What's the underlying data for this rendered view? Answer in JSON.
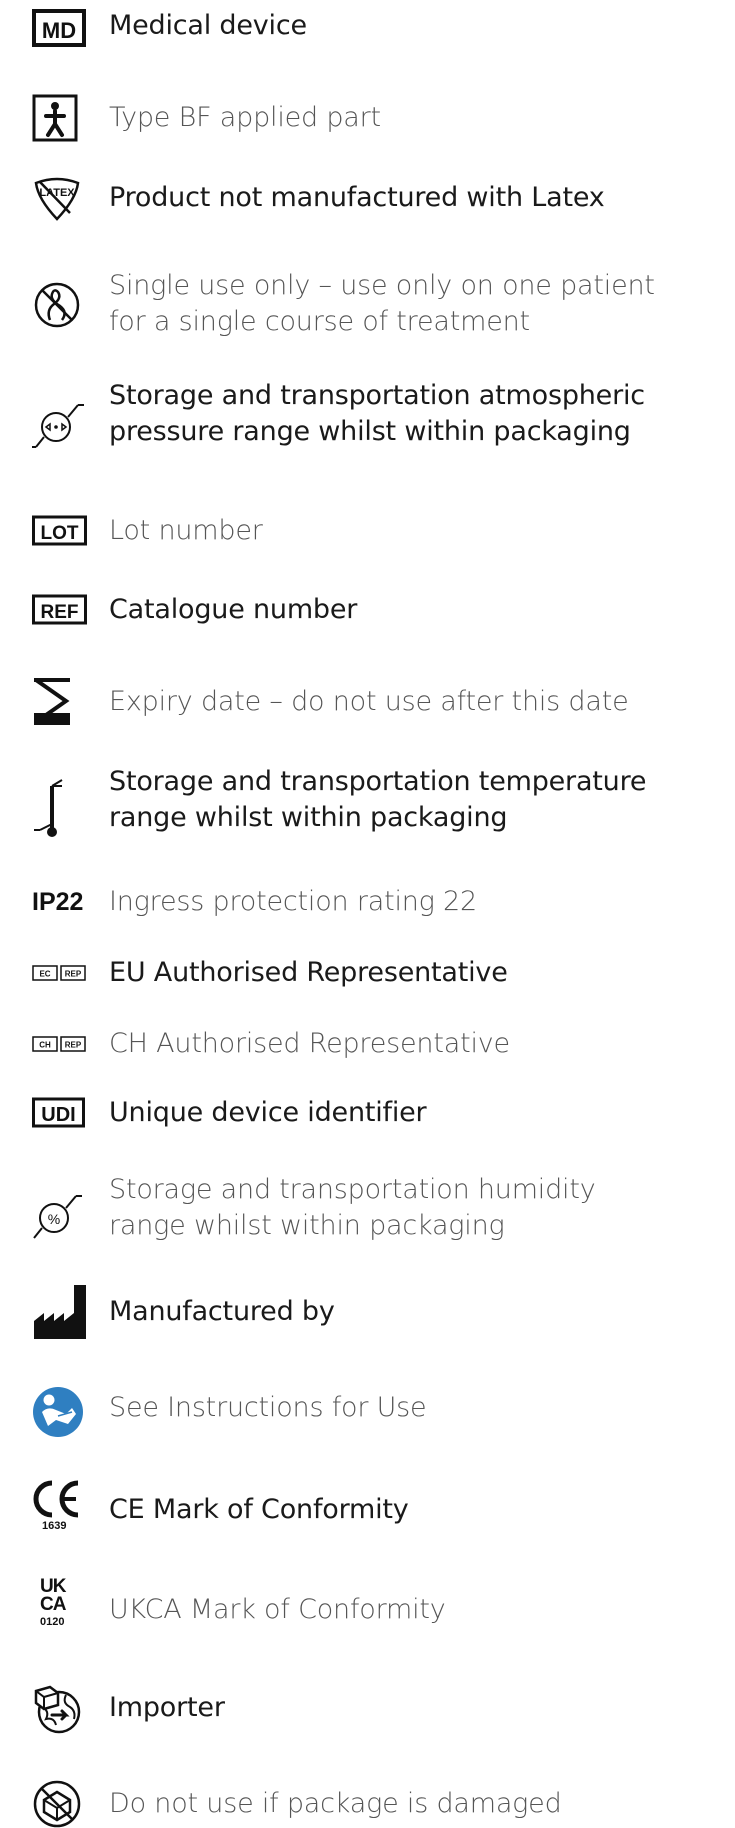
{
  "symbols": [
    {
      "icon": "md-icon",
      "text": "Medical device",
      "style": "bold",
      "lines": 1
    },
    {
      "icon": "type-bf-applied-part-icon",
      "text": "Type BF applied part",
      "style": "light",
      "lines": 1
    },
    {
      "icon": "latex-free-icon",
      "icon_text": "LATEX",
      "text": "Product not manufactured with Latex",
      "style": "bold",
      "lines": 1
    },
    {
      "icon": "single-use-icon",
      "text": "Single use only – use only on one patient for a single course of treatment",
      "style": "light",
      "lines": 2
    },
    {
      "icon": "atmospheric-pressure-icon",
      "text": "Storage and transportation atmospheric pressure range whilst within packaging",
      "style": "bold",
      "lines": 2
    },
    {
      "icon": "lot-icon",
      "icon_text": "LOT",
      "text": "Lot number",
      "style": "light",
      "lines": 1
    },
    {
      "icon": "ref-icon",
      "icon_text": "REF",
      "text": "Catalogue number",
      "style": "bold",
      "lines": 1
    },
    {
      "icon": "hourglass-icon",
      "text": "Expiry date – do not use after this date",
      "style": "light",
      "lines": 1
    },
    {
      "icon": "temperature-limit-icon",
      "text": "Storage and transportation temperature range whilst within packaging",
      "style": "bold",
      "lines": 2
    },
    {
      "icon": "ip22-icon",
      "icon_text": "IP22",
      "text": "Ingress protection rating 22",
      "style": "light",
      "lines": 1
    },
    {
      "icon": "ec-rep-icon",
      "icon_text": "EC|REP",
      "text": "EU Authorised Representative",
      "style": "bold",
      "lines": 1
    },
    {
      "icon": "ch-rep-icon",
      "icon_text": "CH|REP",
      "text": "CH Authorised Representative",
      "style": "light",
      "lines": 1
    },
    {
      "icon": "udi-icon",
      "icon_text": "UDI",
      "text": "Unique device identifier",
      "style": "bold",
      "lines": 1
    },
    {
      "icon": "humidity-icon",
      "icon_text": "%",
      "text": "Storage and transportation humidity range whilst within packaging",
      "style": "light",
      "lines": 2
    },
    {
      "icon": "manufacturer-icon",
      "text": "Manufactured by",
      "style": "bold",
      "lines": 1
    },
    {
      "icon": "instructions-for-use-icon",
      "text": "See Instructions for Use",
      "style": "light",
      "lines": 1
    },
    {
      "icon": "ce-mark-icon",
      "icon_text": "CE",
      "icon_subtext": "1639",
      "text": "CE Mark of Conformity",
      "style": "bold",
      "lines": 1
    },
    {
      "icon": "ukca-mark-icon",
      "icon_text": "UK CA",
      "icon_subtext": "0120",
      "text": "UKCA Mark of Conformity",
      "style": "light",
      "lines": 1
    },
    {
      "icon": "importer-icon",
      "text": "Importer",
      "style": "bold",
      "lines": 1
    },
    {
      "icon": "do-not-use-if-damaged-icon",
      "text": "Do not use if package is damaged",
      "style": "light",
      "lines": 1
    }
  ],
  "colors": {
    "text_dark": "#1a1a1a",
    "text_light": "#555555",
    "icon": "#111111",
    "ifu_blue": "#2f7fc1"
  }
}
